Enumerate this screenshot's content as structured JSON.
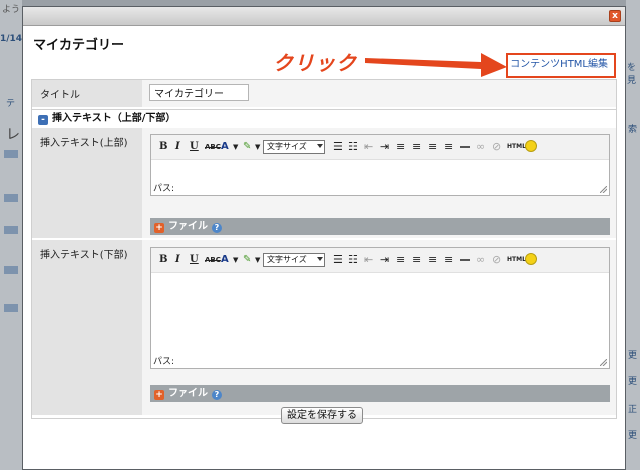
{
  "background": {
    "left_texts": [
      "1/14",
      "テ",
      "レ"
    ],
    "right_texts": [
      "を見",
      "索",
      "更",
      "更",
      "正",
      "更"
    ],
    "top_text": "よう"
  },
  "dialog": {
    "title": "マイカテゴリー",
    "close_label": "x",
    "annotation": "クリック",
    "html_edit_link": "コンテンツHTML編集",
    "title_row": {
      "label": "タイトル",
      "value": "マイカテゴリー"
    },
    "section": {
      "toggle": "-",
      "label": "挿入テキスト（上部/下部）"
    },
    "top_editor": {
      "label": "挿入テキスト(上部)",
      "path_label": "パス:"
    },
    "bottom_editor": {
      "label": "挿入テキスト(下部)",
      "path_label": "パス:"
    },
    "toolbar": {
      "bold": "B",
      "italic": "I",
      "underline": "U",
      "strike": "ABC",
      "font_color": "A",
      "fontsize_select": "文字サイズ",
      "html": "HTML"
    },
    "file_bar": {
      "plus": "+",
      "label": "ファイル",
      "help": "?"
    },
    "save_button": "設定を保存する"
  },
  "colors": {
    "accent_red": "#e4461d",
    "link_blue": "#2456a7",
    "file_bar": "#9ea4a8"
  }
}
